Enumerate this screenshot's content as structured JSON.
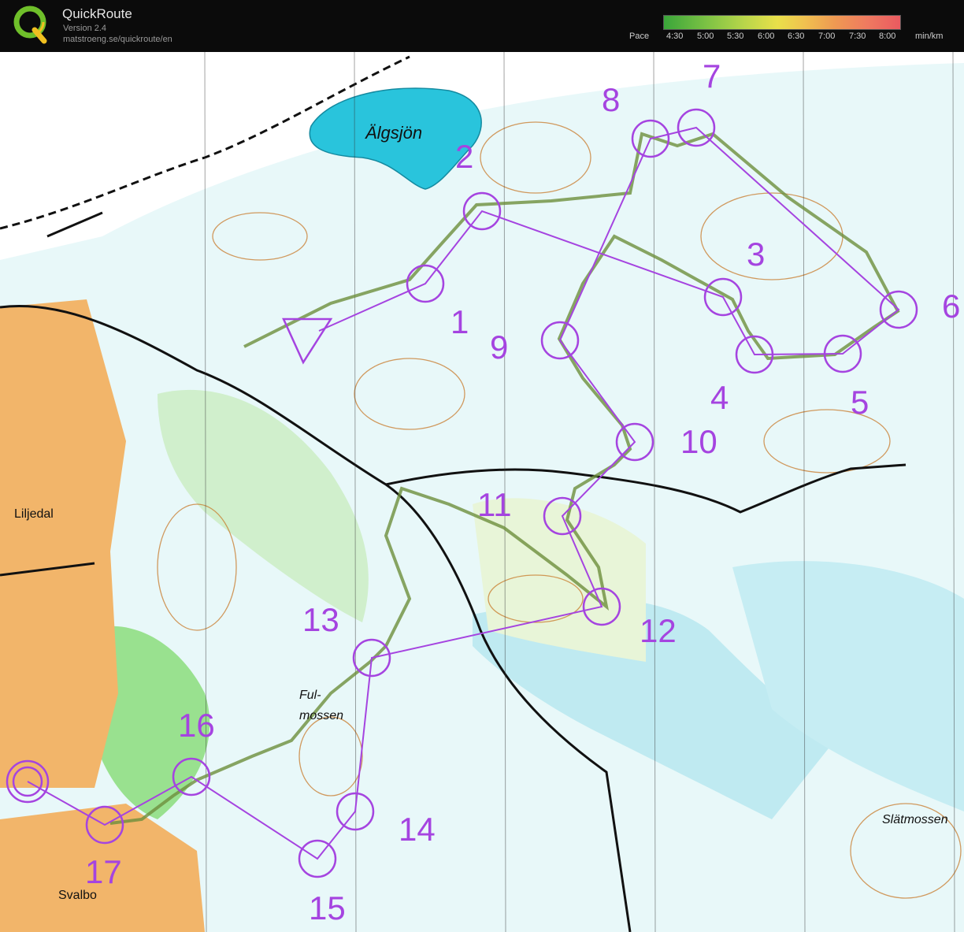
{
  "app": {
    "name": "QuickRoute",
    "version": "Version 2.4",
    "url": "matstroeng.se/quickroute/en"
  },
  "pace_legend": {
    "label": "Pace",
    "ticks": [
      "4:30",
      "5:00",
      "5:30",
      "6:00",
      "6:30",
      "7:00",
      "7:30",
      "8:00"
    ],
    "unit": "min/km",
    "colors": [
      "#3aa53a",
      "#b9d64a",
      "#e9e04a",
      "#ee9a52",
      "#ea5a60"
    ]
  },
  "map": {
    "place_names": {
      "lake": "Älgsjön",
      "liljedal": "Liljedal",
      "fulmossen_1": "Ful-",
      "fulmossen_2": "mossen",
      "svalbo": "Svalbo",
      "slatmossen": "Slätmossen"
    },
    "controls": [
      "1",
      "2",
      "3",
      "4",
      "5",
      "6",
      "7",
      "8",
      "9",
      "10",
      "11",
      "12",
      "13",
      "14",
      "15",
      "16",
      "17"
    ],
    "course_color": "#a544e0"
  }
}
